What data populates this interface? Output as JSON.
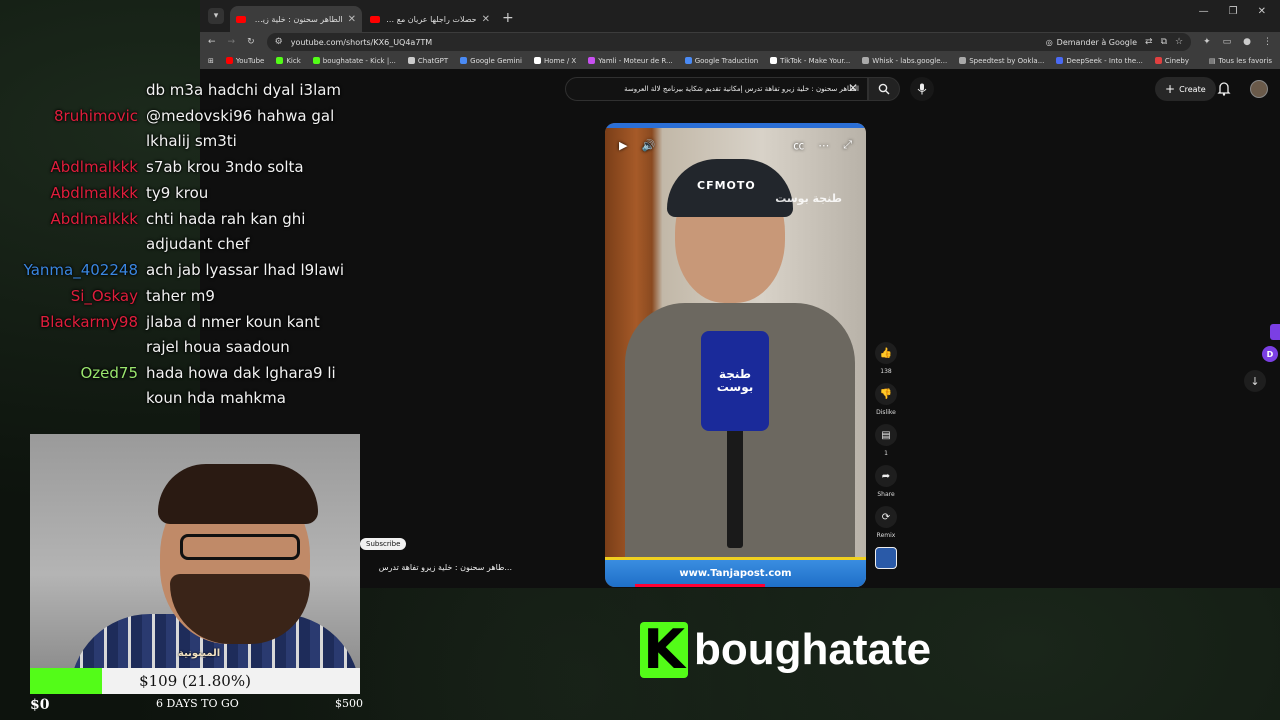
{
  "browser": {
    "tabs": [
      {
        "title": "الطاهر سحنون : خلية زيرو تفاهة تدرس",
        "active": true
      },
      {
        "title": "حصلات راجلها عريان مع وحدة في",
        "active": false
      }
    ],
    "url": "youtube.com/shorts/KX6_UQ4a7TM",
    "google_button": "Demander à Google",
    "bookmarks": [
      {
        "label": "YouTube",
        "color": "#ff0000"
      },
      {
        "label": "Kick",
        "color": "#53fc18"
      },
      {
        "label": "boughatate - Kick |...",
        "color": "#53fc18"
      },
      {
        "label": "ChatGPT",
        "color": "#cccccc"
      },
      {
        "label": "Google Gemini",
        "color": "#4a8af4"
      },
      {
        "label": "Home / X",
        "color": "#ffffff"
      },
      {
        "label": "Yamli - Moteur de R...",
        "color": "#c850f0"
      },
      {
        "label": "Google Traduction",
        "color": "#4a8af4"
      },
      {
        "label": "TikTok - Make Your...",
        "color": "#ffffff"
      },
      {
        "label": "Whisk - labs.google...",
        "color": "#aaaaaa"
      },
      {
        "label": "Speedtest by Ookla...",
        "color": "#aaaaaa"
      },
      {
        "label": "DeepSeek - Into the...",
        "color": "#4a6af4"
      },
      {
        "label": "Cineby",
        "color": "#e04040"
      }
    ],
    "all_bookmarks": "Tous les favoris"
  },
  "youtube": {
    "search_value": "الطاهر سحنون : خلية زيرو تفاهة تدرس إمكانية تقديم شكاية بيرنامج لالة العروسة",
    "create_label": "Create",
    "short": {
      "cap_text": "CFMOTO",
      "mic_text": "طنجة بوست",
      "watermark": "طنجة بوست",
      "footer_text": "www.Tanjapost.com"
    },
    "actions": {
      "like_count": "138",
      "dislike_label": "Dislike",
      "comment_count": "1",
      "share_label": "Share",
      "remix_label": "Remix"
    },
    "subscribe_chip": "Subscribe",
    "short_title": "...طاهر سحنون : خلية زيرو تفاهة تدرس"
  },
  "chat": [
    {
      "user": "",
      "color": "red",
      "message": "db m3a hadchi dyal i3lam"
    },
    {
      "user": "8ruhimovic",
      "color": "red",
      "message": "@medovski96 hahwa gal lkhalij sm3ti"
    },
    {
      "user": "Abdlmalkkk",
      "color": "red",
      "message": "s7ab krou 3ndo solta"
    },
    {
      "user": "Abdlmalkkk",
      "color": "red",
      "message": "ty9 krou"
    },
    {
      "user": "Abdlmalkkk",
      "color": "red",
      "message": "chti hada rah kan ghi adjudant chef"
    },
    {
      "user": "Yanma_402248",
      "color": "blue",
      "message": "ach jab lyassar lhad l9lawi"
    },
    {
      "user": "Si_Oskay",
      "color": "red",
      "message": "taher m9"
    },
    {
      "user": "Blackarmy98",
      "color": "red",
      "message": "jlaba d nmer koun kant rajel houa saadoun"
    },
    {
      "user": "Ozed75",
      "color": "green",
      "message": "hada howa dak lghara9 li koun hda mahkma"
    }
  ],
  "webcam": {
    "shirt_logo": "المينونية"
  },
  "goal": {
    "current": "$109 (21.80%)",
    "fraction": 0.218,
    "min": "$0",
    "max": "$500",
    "days_left": "6 DAYS TO GO"
  },
  "brand": {
    "logo_letter": "K",
    "channel_name": "boughatate",
    "accent_color": "#53fc18"
  }
}
